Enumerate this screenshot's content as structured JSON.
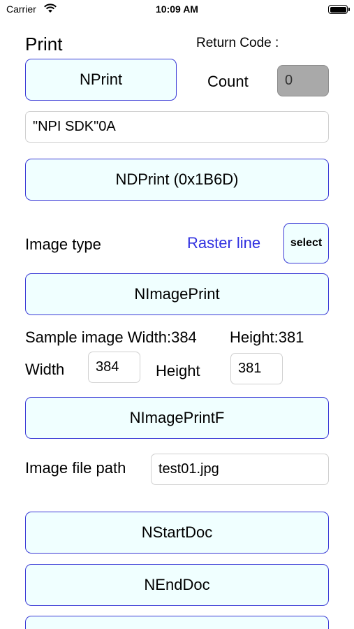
{
  "status_bar": {
    "carrier": "Carrier",
    "time": "10:09 AM",
    "wifi_icon": "wifi-icon",
    "battery_icon": "battery-icon"
  },
  "print_section": {
    "title": "Print",
    "return_code_label": "Return Code :",
    "nprint_button": "NPrint",
    "count_label": "Count",
    "count_value": "0",
    "text_input_value": "\"NPI SDK\"0A",
    "ndprint_button": "NDPrint (0x1B6D)"
  },
  "image_section": {
    "image_type_label": "Image type",
    "image_type_value": "Raster line",
    "select_button": "select",
    "nimageprint_button": "NImagePrint",
    "sample_width_label": "Sample image Width:384",
    "sample_height_label": "Height:381",
    "width_label": "Width",
    "width_value": "384",
    "height_label": "Height",
    "height_value": "381",
    "nimageprintf_button": "NImagePrintF",
    "file_path_label": "Image file path",
    "file_path_value": "test01.jpg"
  },
  "doc_section": {
    "nstartdoc_button": "NStartDoc",
    "nenddoc_button": "NEndDoc"
  },
  "colors": {
    "button_fill": "#f0ffff",
    "button_border": "#3b3bd6",
    "link": "#2f2fe0",
    "count_fill": "#a9a9a9"
  }
}
